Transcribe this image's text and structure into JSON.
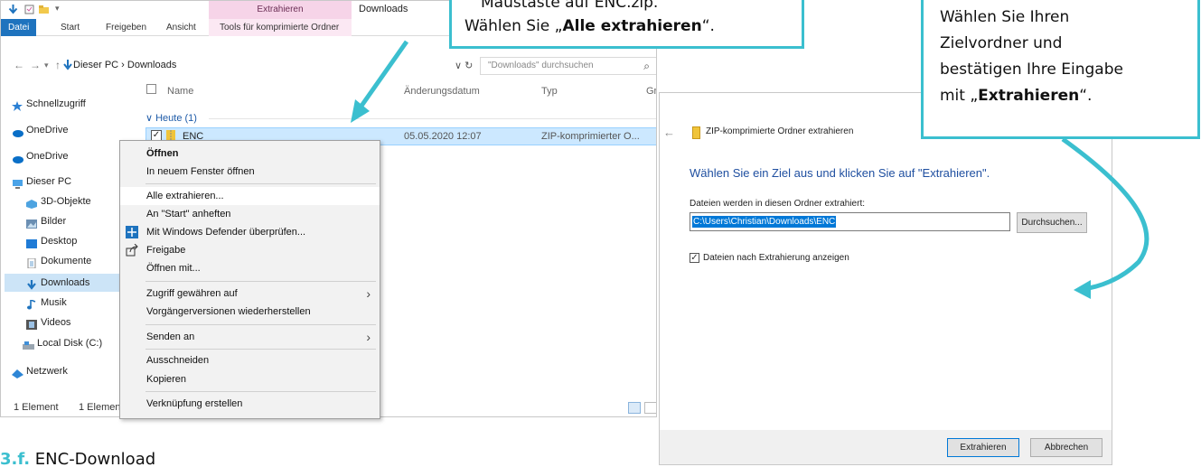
{
  "explorer": {
    "ribbon_context_label": "Extrahieren",
    "window_title": "Downloads",
    "tabs": [
      "Datei",
      "Start",
      "Freigeben",
      "Ansicht",
      "Tools für komprimierte Ordner"
    ],
    "breadcrumb": "Dieser PC  ›  Downloads",
    "search_placeholder": "\"Downloads\" durchsuchen",
    "sidebar": [
      "Schnellzugriff",
      "OneDrive",
      "OneDrive",
      "Dieser PC",
      "3D-Objekte",
      "Bilder",
      "Desktop",
      "Dokumente",
      "Downloads",
      "Musik",
      "Videos",
      "Local Disk (C:)",
      "Netzwerk"
    ],
    "columns": [
      "Name",
      "Änderungsdatum",
      "Typ",
      "Gr"
    ],
    "group": "Heute (1)",
    "file": {
      "name": "ENC",
      "date": "05.05.2020 12:07",
      "type": "ZIP-komprimierter O..."
    },
    "status_left": "1 Element",
    "status_right": "1 Elemen"
  },
  "context_menu": {
    "items": [
      "Öffnen",
      "In neuem Fenster öffnen",
      "Alle extrahieren...",
      "An \"Start\" anheften",
      "Mit Windows Defender überprüfen...",
      "Freigabe",
      "Öffnen mit...",
      "Zugriff gewähren auf",
      "Vorgängerversionen wiederherstellen",
      "Senden an",
      "Ausschneiden",
      "Kopieren",
      "Verknüpfung erstellen"
    ]
  },
  "dialog": {
    "title": "ZIP-komprimierte Ordner extrahieren",
    "heading": "Wählen Sie ein Ziel aus und klicken Sie auf \"Extrahieren\".",
    "label": "Dateien werden in diesen Ordner extrahiert:",
    "path": "C:\\Users\\Christian\\Downloads\\ENC",
    "browse": "Durchsuchen...",
    "checkbox": "Dateien nach Extrahierung anzeigen",
    "extract": "Extrahieren",
    "cancel": "Abbrechen"
  },
  "callout_left": {
    "line1": "Maustaste auf ENC.zip.",
    "line2_pre": "Wählen Sie „",
    "line2_bold": "Alle extrahieren",
    "line2_post": "“."
  },
  "callout_right": {
    "line1": "Wählen Sie Ihren",
    "line2": "Zielvordner und",
    "line3": "bestätigen Ihre Eingabe",
    "line4_pre": "mit „",
    "line4_bold": "Extrahieren",
    "line4_post": "“."
  },
  "caption": {
    "number": "3.f.",
    "text": "ENC-Download"
  },
  "colors": {
    "accent": "#3bbfcf",
    "selection": "#cce8ff",
    "file_tab": "#1e73be",
    "context_tab": "#f6d4e8"
  }
}
